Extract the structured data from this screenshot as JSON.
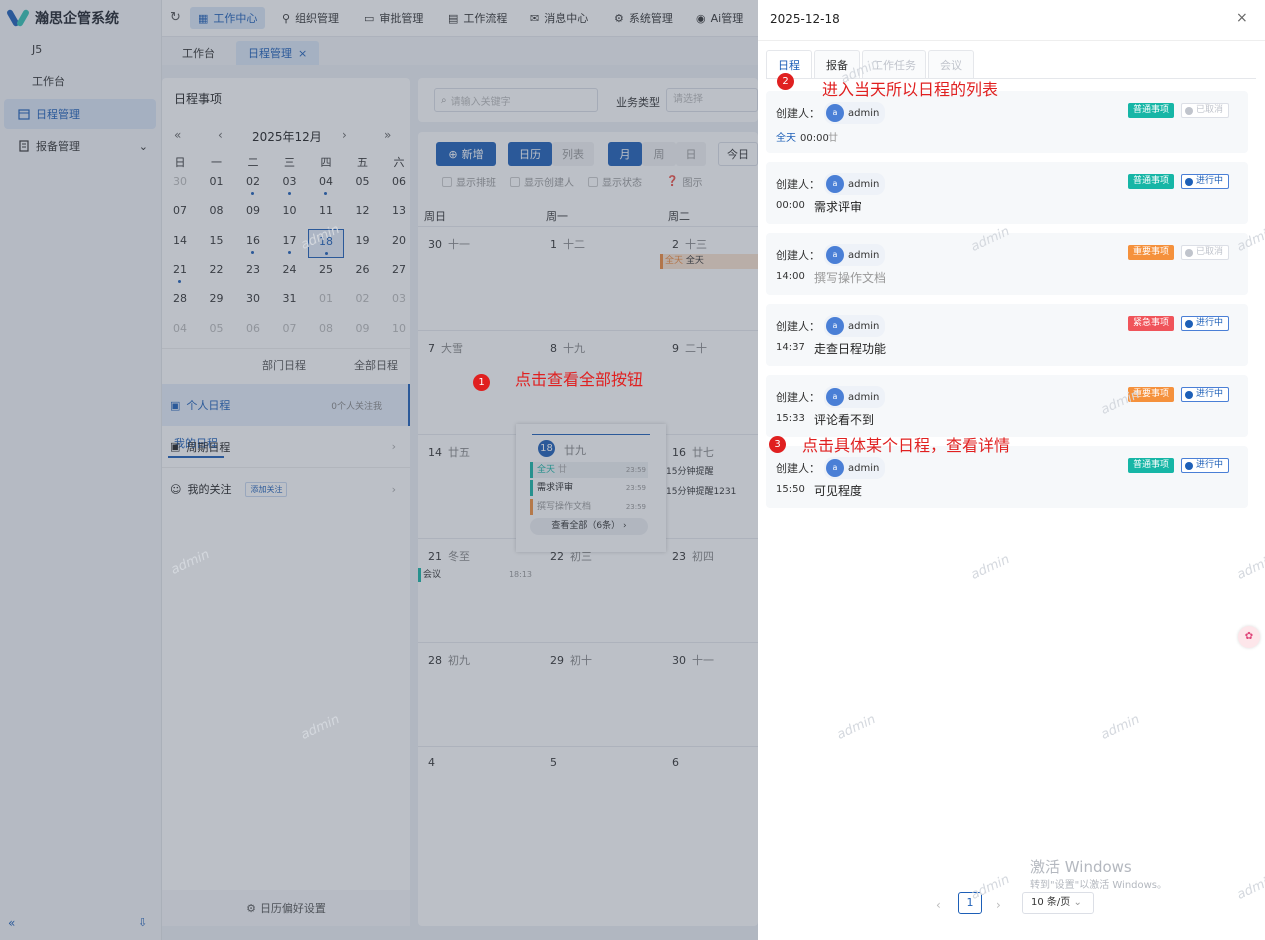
{
  "app": {
    "title": "瀚思企管系统"
  },
  "nav": {
    "items": [
      {
        "label": "J5"
      },
      {
        "label": "工作台"
      },
      {
        "label": "日程管理"
      },
      {
        "label": "报备管理"
      }
    ]
  },
  "topbar": {
    "items": [
      {
        "label": "工作中心"
      },
      {
        "label": "组织管理"
      },
      {
        "label": "审批管理"
      },
      {
        "label": "工作流程"
      },
      {
        "label": "消息中心"
      },
      {
        "label": "系统管理"
      },
      {
        "label": "Ai管理"
      }
    ]
  },
  "tabs": [
    {
      "label": "工作台"
    },
    {
      "label": "日程管理"
    }
  ],
  "left": {
    "title": "日程事项",
    "month": "2025年12月",
    "weekdays": [
      "日",
      "一",
      "二",
      "三",
      "四",
      "五",
      "六"
    ],
    "days": [
      [
        "30",
        "01",
        "02",
        "03",
        "04",
        "05",
        "06"
      ],
      [
        "07",
        "08",
        "09",
        "10",
        "11",
        "12",
        "13"
      ],
      [
        "14",
        "15",
        "16",
        "17",
        "18",
        "19",
        "20"
      ],
      [
        "21",
        "22",
        "23",
        "24",
        "25",
        "26",
        "27"
      ],
      [
        "28",
        "29",
        "30",
        "31",
        "01",
        "02",
        "03"
      ],
      [
        "04",
        "05",
        "06",
        "07",
        "08",
        "09",
        "10"
      ]
    ],
    "sched_tabs": [
      "我的日程",
      "部门日程",
      "全部日程"
    ],
    "rows": [
      {
        "label": "个人日程",
        "extra": "0个人关注我"
      },
      {
        "label": "周期日程"
      },
      {
        "label": "我的关注",
        "extra": "添加关注"
      }
    ],
    "settings": "日历偏好设置"
  },
  "main": {
    "search_placeholder": "请输入关键字",
    "biz_label": "业务类型",
    "biz_placeholder": "请选择",
    "new_btn": "新增",
    "view_calendar": "日历",
    "view_list": "列表",
    "mode_month": "月",
    "mode_week": "周",
    "mode_day": "日",
    "today": "今日",
    "checks": [
      "显示排班",
      "显示创建人",
      "显示状态",
      "图示"
    ],
    "colheads": [
      "周日",
      "周一",
      "周二"
    ],
    "cells": [
      {
        "n": "30",
        "l": "十一"
      },
      {
        "n": "1",
        "l": "十二"
      },
      {
        "n": "2",
        "l": "十三"
      },
      {
        "n": "7",
        "l": "大雪"
      },
      {
        "n": "8",
        "l": "十九"
      },
      {
        "n": "9",
        "l": "二十"
      },
      {
        "n": "14",
        "l": "廿五"
      },
      {
        "n": "",
        "l": ""
      },
      {
        "n": "16",
        "l": "廿七"
      },
      {
        "n": "21",
        "l": "冬至"
      },
      {
        "n": "22",
        "l": "初三"
      },
      {
        "n": "23",
        "l": "初四"
      },
      {
        "n": "28",
        "l": "初九"
      },
      {
        "n": "29",
        "l": "初十"
      },
      {
        "n": "30",
        "l": "十一"
      },
      {
        "n": "4",
        "l": ""
      },
      {
        "n": "5",
        "l": ""
      },
      {
        "n": "6",
        "l": ""
      }
    ],
    "event_allday": "全天",
    "event_allday2": "全天",
    "event_16a": "15分钟提醒",
    "event_16b": "15分钟提醒1231",
    "event_meeting": "会议",
    "event_meeting_time": "18:13"
  },
  "popup": {
    "day_num": "18",
    "day_lunar": "廿九",
    "items": [
      {
        "title": "全天",
        "extra": "廿",
        "time": "23:59"
      },
      {
        "title": "需求评审",
        "time": "23:59"
      },
      {
        "title": "撰写操作文档",
        "time": "23:59"
      }
    ],
    "view_all": "查看全部（6条）"
  },
  "drawer": {
    "date": "2025-12-18",
    "tabs": [
      "日程",
      "报备",
      "工作任务",
      "会议"
    ],
    "creator_label": "创建人：",
    "cards": [
      {
        "user": "admin",
        "tag": "普通事项",
        "tag_color": "#16b6a6",
        "status": "已取消",
        "off": true,
        "allday": "全天",
        "time": "00:00",
        "title": "廿"
      },
      {
        "user": "admin",
        "tag": "普通事项",
        "tag_color": "#16b6a6",
        "status": "进行中",
        "off": false,
        "time": "00:00",
        "title": "需求评审"
      },
      {
        "user": "admin",
        "tag": "重要事项",
        "tag_color": "#f5913c",
        "status": "已取消",
        "off": true,
        "time": "14:00",
        "title": "撰写操作文档"
      },
      {
        "user": "admin",
        "tag": "紧急事项",
        "tag_color": "#f0545a",
        "status": "进行中",
        "off": false,
        "time": "14:37",
        "title": "走查日程功能"
      },
      {
        "user": "admin",
        "tag": "重要事项",
        "tag_color": "#f5913c",
        "status": "进行中",
        "off": false,
        "time": "15:33",
        "title": "评论看不到"
      },
      {
        "user": "admin",
        "tag": "普通事项",
        "tag_color": "#16b6a6",
        "status": "进行中",
        "off": false,
        "time": "15:50",
        "title": "可见程度"
      }
    ],
    "page": "1",
    "page_size": "10 条/页"
  },
  "annotations": {
    "a1": "点击查看全部按钮",
    "a2": "进入当天所以日程的列表",
    "a3": "点击具体某个日程，查看详情",
    "n1": "1",
    "n2": "2",
    "n3": "3"
  },
  "watermark": "admin",
  "activate": {
    "line1": "激活 Windows",
    "line2": "转到\"设置\"以激活 Windows。"
  }
}
